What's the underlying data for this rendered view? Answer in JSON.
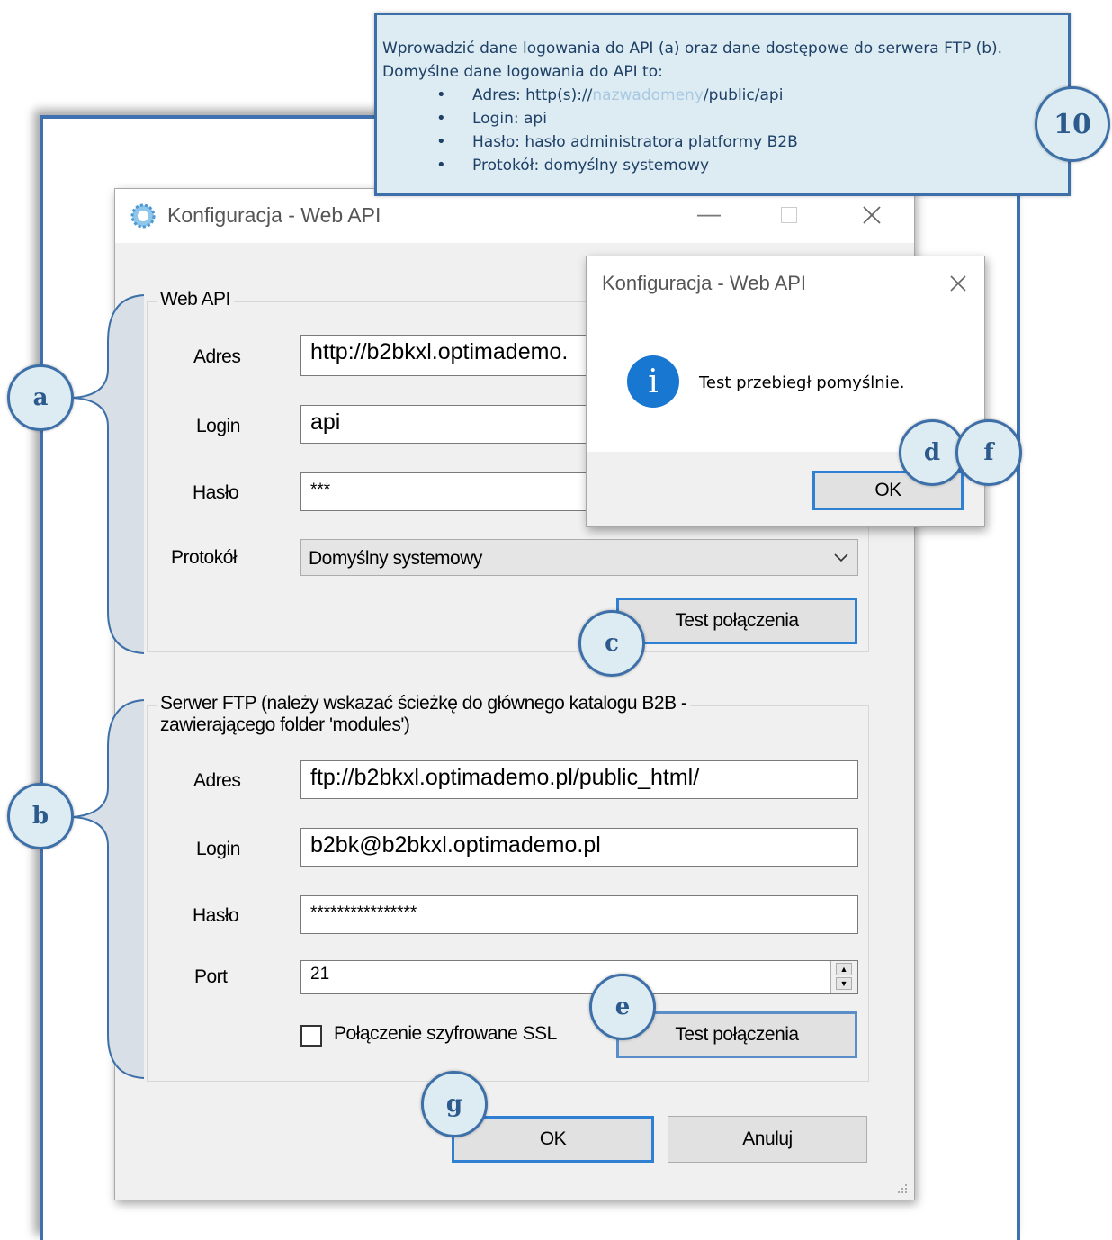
{
  "note": {
    "intro_line1": "Wprowadzić dane logowania do API (a) oraz dane dostępowe do serwera FTP (b).",
    "intro_line2": "Domyślne dane logowania do API to:",
    "bullets": {
      "adres_prefix": "Adres: http(s)://",
      "adres_domain": "nazwadomeny",
      "adres_suffix": "/public/api",
      "login": "Login: api",
      "haslo": "Hasło: hasło administratora platformy B2B",
      "protokol": "Protokół: domyślny systemowy"
    },
    "step_number": "10"
  },
  "dialog": {
    "title": "Konfiguracja - Web API",
    "web_api": {
      "group_label": "Web API",
      "adres_label": "Adres",
      "adres_value": "http://b2bkxl.optimademo.",
      "login_label": "Login",
      "login_value": "api",
      "haslo_label": "Hasło",
      "haslo_value": "***",
      "protokol_label": "Protokół",
      "protokol_value": "Domyślny systemowy",
      "test_button": "Test połączenia"
    },
    "ftp": {
      "group_label_line1": "Serwer FTP (należy wskazać ścieżkę do głównego katalogu B2B -",
      "group_label_line2": "zawierającego folder 'modules')",
      "adres_label": "Adres",
      "adres_value": "ftp://b2bkxl.optimademo.pl/public_html/",
      "login_label": "Login",
      "login_value": "b2bk@b2bkxl.optimademo.pl",
      "haslo_label": "Hasło",
      "haslo_value": "****************",
      "port_label": "Port",
      "port_value": "21",
      "ssl_label": "Połączenie szyfrowane SSL",
      "ssl_checked": false,
      "test_button": "Test połączenia"
    },
    "ok_button": "OK",
    "cancel_button": "Anuluj"
  },
  "message_box": {
    "title": "Konfiguracja - Web API",
    "message": "Test przebiegł pomyślnie.",
    "ok_button": "OK"
  },
  "markers": {
    "a": "a",
    "b": "b",
    "c": "c",
    "d": "d",
    "e": "e",
    "f": "f",
    "g": "g"
  },
  "colors": {
    "note_bg": "#dcecf2",
    "note_border": "#3d6fa8",
    "focus_blue": "#2f7fd2",
    "info_icon": "#1877d0"
  }
}
